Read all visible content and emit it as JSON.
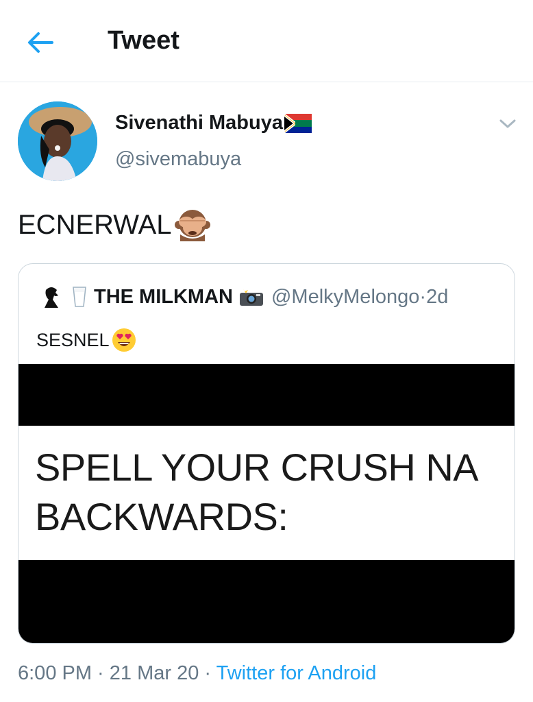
{
  "header": {
    "title": "Tweet",
    "back_icon": "arrow-left-icon",
    "accent": "#1da1f2"
  },
  "tweet": {
    "author_name": "Sivenathi Mabuya",
    "author_handle": "@sivemabuya",
    "text": "ECNERWAL",
    "time": "6:00 PM",
    "date": "21 Mar 20",
    "source": "Twitter for Android",
    "sep": " · "
  },
  "quote": {
    "name": "THE MILKMAN",
    "handle": "@MelkyMelongo",
    "age": "2d",
    "text": "SESNEL",
    "image_line1": "SPELL YOUR CRUSH NA",
    "image_line2": "BACKWARDS:"
  },
  "colors": {
    "text": "#14171a",
    "secondary": "#657786",
    "link": "#1da1f2",
    "border": "#ccd6dd"
  }
}
